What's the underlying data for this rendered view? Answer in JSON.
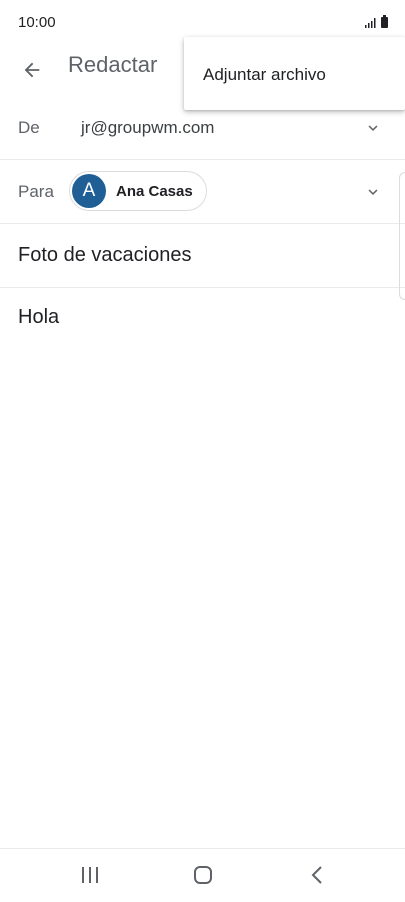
{
  "status_bar": {
    "time": "10:00"
  },
  "app_bar": {
    "title": "Redactar",
    "back_icon": "arrow-left-icon"
  },
  "compose": {
    "from_label": "De",
    "from_value": "jr@groupwm.com",
    "to_label": "Para",
    "recipient": {
      "initial": "A",
      "name": "Ana Casas",
      "avatar_color": "#1f5f96"
    },
    "subject": "Foto de vacaciones",
    "body": "Hola"
  },
  "menu": {
    "items": [
      {
        "label": "Adjuntar archivo"
      }
    ]
  },
  "nav_bar": {
    "icons": [
      "recents-icon",
      "home-icon",
      "back-icon"
    ]
  }
}
